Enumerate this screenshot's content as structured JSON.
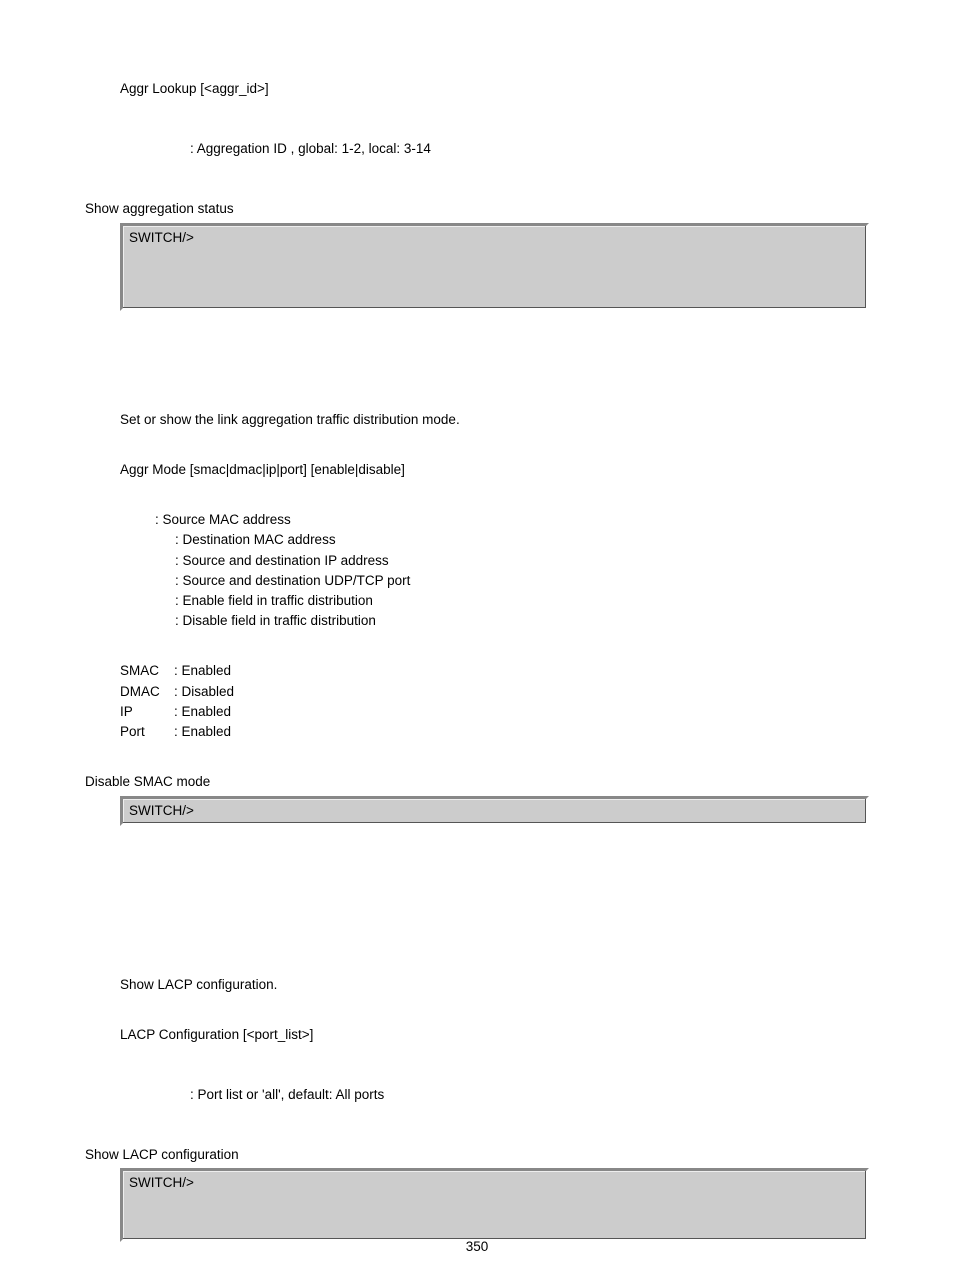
{
  "sec1": {
    "syntax": "Aggr Lookup [<aggr_id>]",
    "param": ": Aggregation ID , global: 1-2, local: 3-14",
    "example_intro": "Show aggregation status",
    "code": "SWITCH/>"
  },
  "sec2": {
    "desc": "Set or show the link aggregation traffic distribution mode.",
    "syntax": "Aggr Mode [smac|dmac|ip|port] [enable|disable]",
    "params": [
      ": Source MAC address",
      ": Destination MAC address",
      ": Source and destination IP address",
      ": Source and destination UDP/TCP port",
      ": Enable field in traffic distribution",
      ": Disable field in traffic distribution"
    ],
    "defaults": [
      {
        "k": "SMAC",
        "v": ": Enabled"
      },
      {
        "k": "DMAC",
        "v": ": Disabled"
      },
      {
        "k": "IP",
        "v": ": Enabled"
      },
      {
        "k": "Port",
        "v": ": Enabled"
      }
    ],
    "example_intro": "Disable SMAC mode",
    "code": "SWITCH/>"
  },
  "sec3": {
    "desc": "Show LACP configuration.",
    "syntax": "LACP Configuration [<port_list>]",
    "param": ": Port list or 'all', default: All ports",
    "example_intro": "Show LACP configuration",
    "code": "SWITCH/>"
  },
  "page_number": "350"
}
